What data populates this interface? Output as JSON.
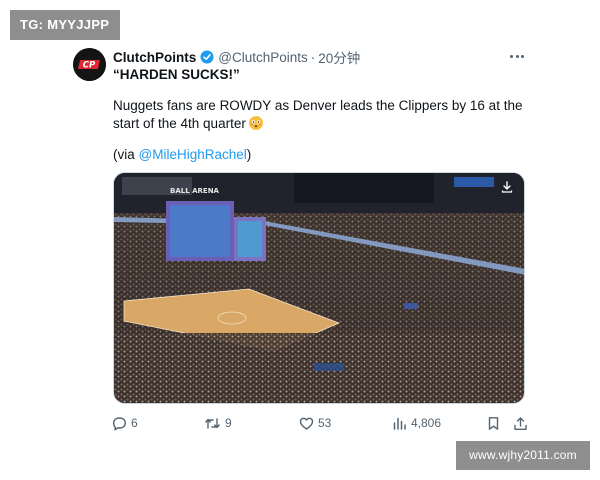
{
  "watermarks": {
    "top": "TG: MYYJJPP",
    "bottom": "www.wjhy2011.com"
  },
  "tweet": {
    "author_name": "ClutchPoints",
    "handle": "@ClutchPoints",
    "separator": "·",
    "time": "20分钟",
    "headline": "“HARDEN SUCKS!”",
    "body": "Nuggets fans are ROWDY as Denver leads the Clippers by 16 at the start of the 4th quarter",
    "via_prefix": "(via ",
    "via_mention": "@MileHighRachel",
    "via_suffix": ")",
    "avatar_text": "CP",
    "arena_sign": "BALL ARENA"
  },
  "actions": {
    "replies": "6",
    "retweets": "9",
    "likes": "53",
    "views": "4,806"
  },
  "colors": {
    "link": "#1d9bf0",
    "muted": "#536471",
    "avatar_red": "#e0262f",
    "court": "#d9a866"
  }
}
